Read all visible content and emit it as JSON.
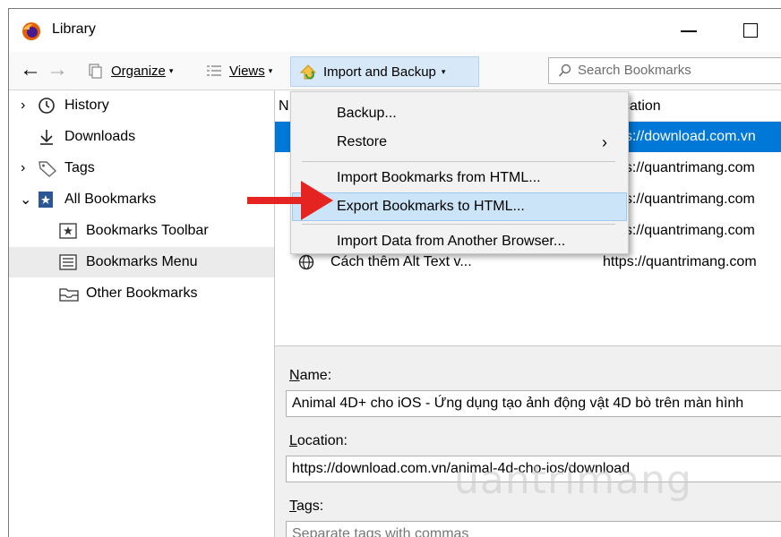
{
  "window": {
    "title": "Library"
  },
  "toolbar": {
    "back_icon": "back-arrow-icon",
    "forward_icon": "forward-arrow-icon",
    "organize": "Organize",
    "views": "Views",
    "import_backup": "Import and Backup",
    "search_placeholder": "Search Bookmarks"
  },
  "sidebar": {
    "items": [
      {
        "label": "History",
        "icon": "clock-icon",
        "expander": "›"
      },
      {
        "label": "Downloads",
        "icon": "download-icon"
      },
      {
        "label": "Tags",
        "icon": "tag-icon",
        "expander": "›"
      },
      {
        "label": "All Bookmarks",
        "icon": "bookmarks-star-icon",
        "expander": "⌄"
      },
      {
        "label": "Bookmarks Toolbar",
        "icon": "toolbar-star-icon"
      },
      {
        "label": "Bookmarks Menu",
        "icon": "menu-list-icon"
      },
      {
        "label": "Other Bookmarks",
        "icon": "folder-icon"
      }
    ]
  },
  "content": {
    "header_name": "N",
    "header_location": "cation",
    "rows": [
      {
        "name": "",
        "location": "ps://download.com.vn"
      },
      {
        "name": "",
        "location": "ps://quantrimang.com"
      },
      {
        "name": "",
        "location": "ps://quantrimang.com"
      },
      {
        "name": "",
        "location": "ps://quantrimang.com"
      },
      {
        "name": "Cách thêm Alt Text v...",
        "location": "https://quantrimang.com"
      }
    ]
  },
  "menu": {
    "items": [
      {
        "label": "Backup..."
      },
      {
        "label": "Restore",
        "submenu": "›"
      },
      {
        "label": "Import Bookmarks from HTML..."
      },
      {
        "label": "Export Bookmarks to HTML..."
      },
      {
        "label": "Import Data from Another Browser..."
      }
    ]
  },
  "details": {
    "name_label": "Name:",
    "name_value": "Animal 4D+ cho iOS - Ứng dụng tạo ảnh động vật 4D bò trên màn hình",
    "location_label": "Location:",
    "location_value": "https://download.com.vn/animal-4d-cho-ios/download",
    "tags_label": "Tags:",
    "tags_placeholder": "Separate tags with commas"
  },
  "watermark": "uantrimang",
  "colors": {
    "selection": "#0078d7",
    "menu_highlight": "#cce4f7",
    "arrow": "#e52421"
  }
}
